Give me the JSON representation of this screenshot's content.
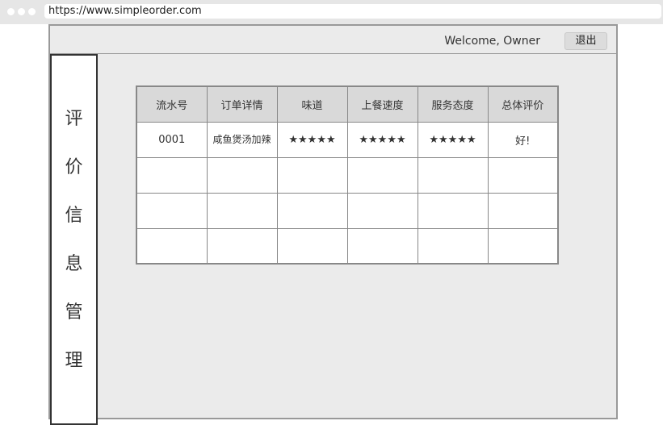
{
  "browser": {
    "url": "https://www.simpleorder.com"
  },
  "header": {
    "welcome": "Welcome, Owner",
    "logout_label": "退出"
  },
  "sidebar": {
    "chars": [
      "评",
      "价",
      "信",
      "息",
      "管",
      "理"
    ]
  },
  "table": {
    "columns": [
      "流水号",
      "订单详情",
      "味道",
      "上餐速度",
      "服务态度",
      "总体评价"
    ],
    "rows": [
      [
        "0001",
        "咸鱼煲汤加辣",
        "★★★★★",
        "★★★★★",
        "★★★★★",
        "好!"
      ],
      [
        "",
        "",
        "",
        "",
        "",
        ""
      ],
      [
        "",
        "",
        "",
        "",
        "",
        ""
      ],
      [
        "",
        "",
        "",
        "",
        "",
        ""
      ]
    ]
  }
}
